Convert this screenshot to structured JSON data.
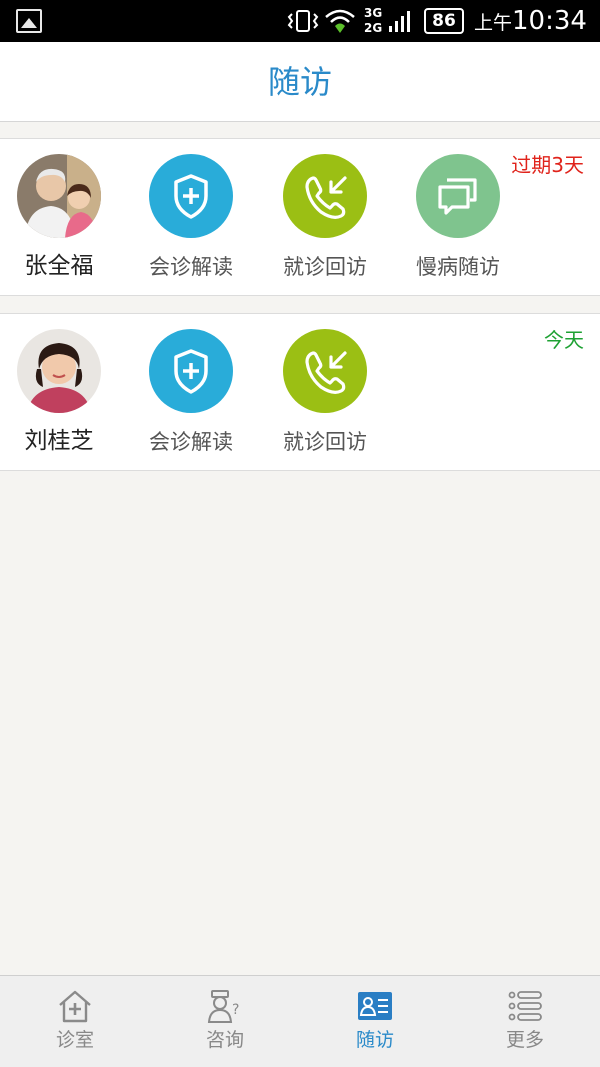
{
  "status_bar": {
    "battery": "86",
    "time_prefix": "上午",
    "time": "10:34",
    "network_top": "3G",
    "network_bottom": "2G"
  },
  "header": {
    "title": "随访"
  },
  "patients": [
    {
      "name": "张全福",
      "tag": "过期3天",
      "tag_color": "#e0231b",
      "actions": [
        {
          "label": "会诊解读",
          "icon": "shield-plus-icon",
          "color": "#29acd9"
        },
        {
          "label": "就诊回访",
          "icon": "phone-callback-icon",
          "color": "#9bbf14"
        },
        {
          "label": "慢病随访",
          "icon": "chat-bubbles-icon",
          "color": "#7fc48e"
        }
      ]
    },
    {
      "name": "刘桂芝",
      "tag": "今天",
      "tag_color": "#1ea133",
      "actions": [
        {
          "label": "会诊解读",
          "icon": "shield-plus-icon",
          "color": "#29acd9"
        },
        {
          "label": "就诊回访",
          "icon": "phone-callback-icon",
          "color": "#9bbf14"
        }
      ]
    }
  ],
  "bottom_nav": [
    {
      "label": "诊室",
      "icon": "house-plus-icon",
      "active": false
    },
    {
      "label": "咨询",
      "icon": "doctor-question-icon",
      "active": false
    },
    {
      "label": "随访",
      "icon": "followup-card-icon",
      "active": true
    },
    {
      "label": "更多",
      "icon": "list-icon",
      "active": false
    }
  ],
  "colors": {
    "accent": "#2a8ac9",
    "background": "#f5f4f1"
  }
}
